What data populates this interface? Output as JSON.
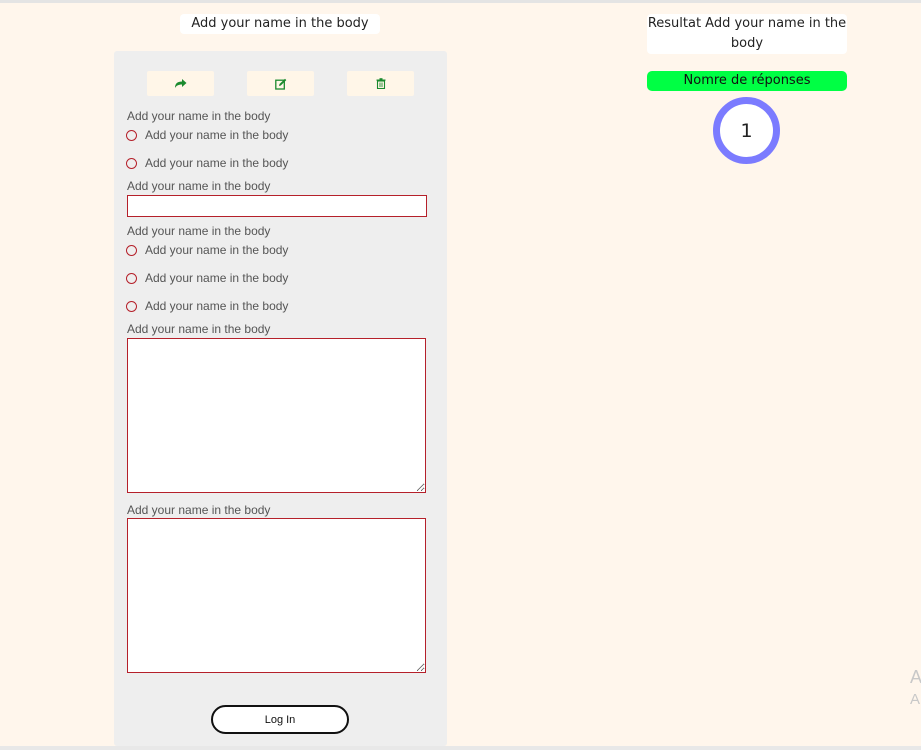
{
  "page": {
    "title": "Add your name in the body"
  },
  "toolbar": {
    "icons": [
      "share-icon",
      "edit-icon",
      "trash-icon"
    ],
    "icon_color": "#1a8a2e"
  },
  "form": {
    "questions": [
      {
        "type": "radio",
        "label": "Add your name in the body",
        "options": [
          "Add your name in the body",
          "Add your name in the body"
        ]
      },
      {
        "type": "text",
        "label": "Add your name in the body",
        "value": ""
      },
      {
        "type": "radio",
        "label": "Add your name in the body",
        "options": [
          "Add your name in the body",
          "Add your name in the body",
          "Add your name in the body"
        ]
      },
      {
        "type": "textarea",
        "label": "Add your name in the body",
        "value": ""
      },
      {
        "type": "textarea",
        "label": "Add your name in the body",
        "value": ""
      }
    ],
    "submit_label": "Log In"
  },
  "results": {
    "title": "Resultat Add your name in the body",
    "responses_label": "Nomre de réponses",
    "count": "1"
  },
  "watermark": {
    "line1": "A",
    "line2": "A"
  },
  "colors": {
    "background": "#fff6ec",
    "card": "#eeeeee",
    "accent_red": "#b5202a",
    "responses_green": "#00ff44",
    "ring_blue": "#7b7bff"
  }
}
